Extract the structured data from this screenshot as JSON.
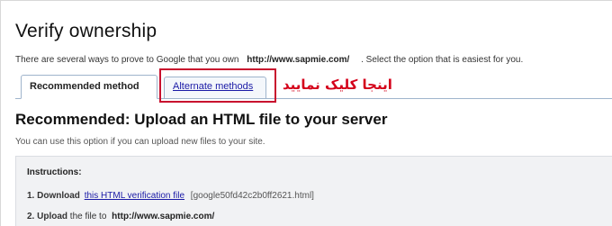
{
  "page": {
    "title": "Verify ownership"
  },
  "intro": {
    "before": "There are several ways to prove to Google that you own",
    "site": "http://www.sapmie.com/",
    "after": ". Select the option that is easiest for you."
  },
  "tabs": [
    {
      "label": "Recommended method",
      "active": true
    },
    {
      "label": "Alternate methods",
      "active": false
    }
  ],
  "annotation": {
    "text": "اینجا کلیک نمایید",
    "color": "#d4001a"
  },
  "section": {
    "title": "Recommended: Upload an HTML file to your server",
    "description": "You can use this option if you can upload new files to your site."
  },
  "instructions": {
    "title": "Instructions:",
    "steps": [
      {
        "number": "1.",
        "verb": "Download",
        "link": "this HTML verification file",
        "filename": "[google50fd42c2b0ff2621.html]"
      },
      {
        "number": "2.",
        "verb": "Upload",
        "text": "the file to",
        "site": "http://www.sapmie.com/"
      }
    ]
  },
  "colors": {
    "link": "#1a1aa6",
    "highlight_border": "#c8102e",
    "tab_border": "#9fb4cc",
    "instructions_bg": "#f1f2f4"
  }
}
